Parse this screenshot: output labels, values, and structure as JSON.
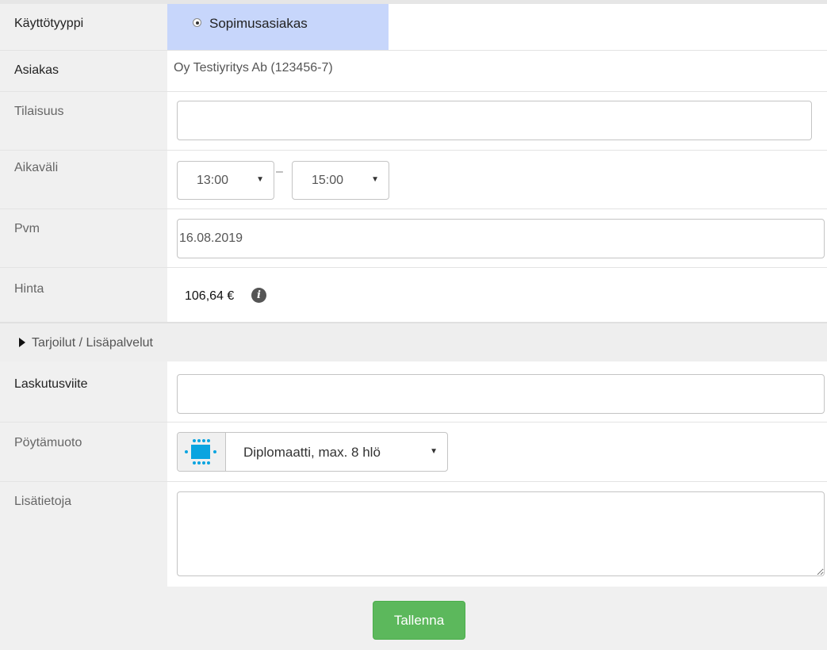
{
  "form": {
    "user_type": {
      "label": "Käyttötyyppi",
      "option": "Sopimusasiakas"
    },
    "customer": {
      "label": "Asiakas",
      "value": "Oy Testiyritys Ab (123456-7)"
    },
    "occasion": {
      "label": "Tilaisuus",
      "value": ""
    },
    "time_range": {
      "label": "Aikaväli",
      "start": "13:00",
      "separator": "–",
      "end": "15:00"
    },
    "date": {
      "label": "Pvm",
      "value": "16.08.2019"
    },
    "price": {
      "label": "Hinta",
      "value": "106,64 €"
    },
    "extras_toggle": {
      "label": "Tarjoilut / Lisäpalvelut"
    },
    "billing_ref": {
      "label": "Laskutusviite",
      "value": ""
    },
    "table_layout": {
      "label": "Pöytämuoto",
      "selected": "Diplomaatti, max. 8 hlö",
      "icon": "conference-table-icon"
    },
    "additional_info": {
      "label": "Lisätietoja",
      "value": ""
    }
  },
  "actions": {
    "save_label": "Tallenna"
  },
  "colors": {
    "selected_bg": "#c7d6fb",
    "save_button": "#5cb85c",
    "table_icon": "#0aa4e0"
  }
}
